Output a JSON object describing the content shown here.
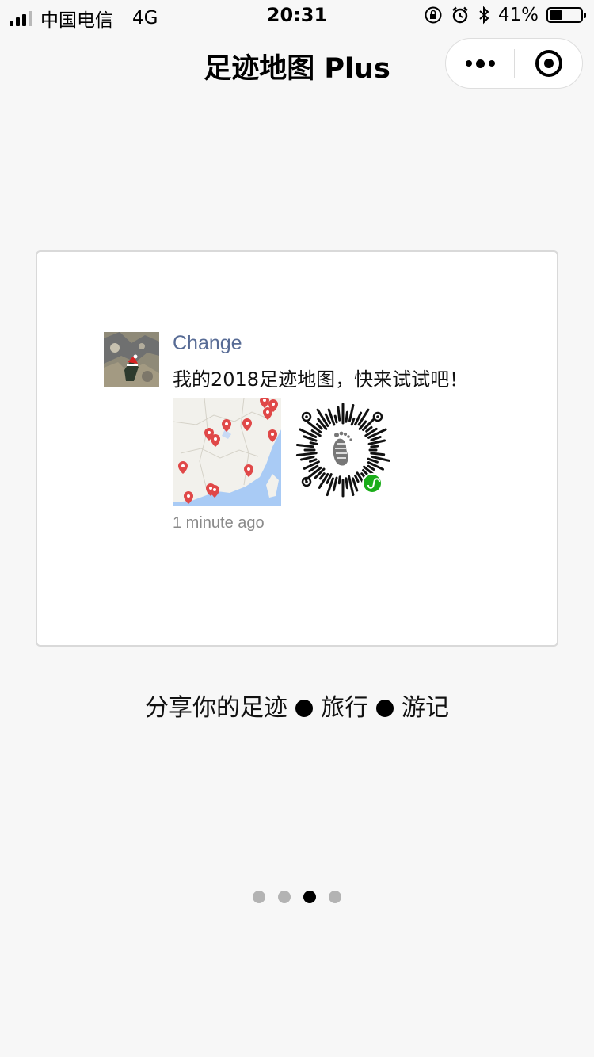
{
  "status_bar": {
    "carrier": "中国电信",
    "network": "4G",
    "time": "20:31",
    "battery_percent": "41%",
    "battery_level": 0.41,
    "icons": [
      "signal-icon",
      "orientation-lock-icon",
      "alarm-icon",
      "bluetooth-icon",
      "battery-icon"
    ]
  },
  "nav": {
    "title": "足迹地图 Plus",
    "more_icon": "more-dots-icon",
    "close_icon": "target-close-icon"
  },
  "post": {
    "username": "Change",
    "text": "我的2018足迹地图，快来试试吧！",
    "timestamp": "1 minute ago",
    "colors": {
      "username": "#576b95",
      "pin": "#e04848",
      "sea": "#a9cbf5"
    }
  },
  "tagline": {
    "part1": "分享你的足迹",
    "part2": "旅行",
    "part3": "游记"
  },
  "pager": {
    "count": 4,
    "active_index": 2
  }
}
